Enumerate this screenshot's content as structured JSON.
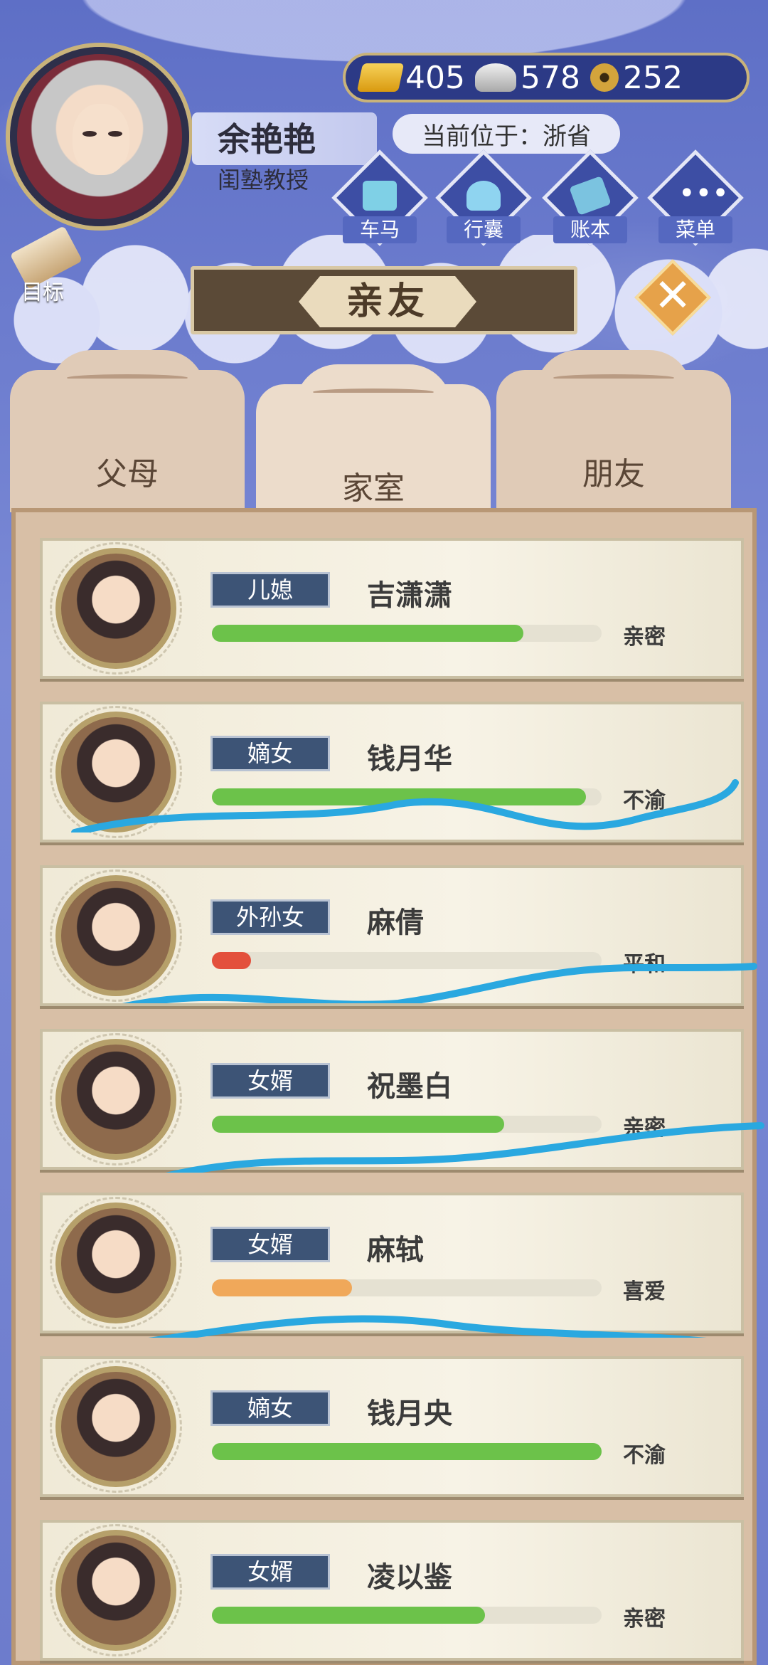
{
  "player": {
    "name": "余艳艳",
    "title": "闺塾教授",
    "location": "当前位于：浙省"
  },
  "currency": {
    "gold": "405",
    "silver": "578",
    "coins": "252"
  },
  "nav": {
    "carriage": "车马",
    "luggage": "行囊",
    "ledger": "账本",
    "menu": "菜单",
    "goal": "目标"
  },
  "page": {
    "title": "亲友"
  },
  "tabs": [
    {
      "label": "父母"
    },
    {
      "label": "家室"
    },
    {
      "label": "朋友"
    }
  ],
  "members": [
    {
      "relation": "儿媳",
      "name": "吉潇潇",
      "mood": "亲密",
      "affinity": 0.8,
      "color": "#6cc24a"
    },
    {
      "relation": "嫡女",
      "name": "钱月华",
      "mood": "不渝",
      "affinity": 0.96,
      "color": "#6cc24a"
    },
    {
      "relation": "外孙女",
      "name": "麻倩",
      "mood": "平和",
      "affinity": 0.1,
      "color": "#e3503c"
    },
    {
      "relation": "女婿",
      "name": "祝墨白",
      "mood": "亲密",
      "affinity": 0.75,
      "color": "#6cc24a"
    },
    {
      "relation": "女婿",
      "name": "麻轼",
      "mood": "喜爱",
      "affinity": 0.36,
      "color": "#f0a85a"
    },
    {
      "relation": "嫡女",
      "name": "钱月央",
      "mood": "不渝",
      "affinity": 1.0,
      "color": "#6cc24a"
    },
    {
      "relation": "女婿",
      "name": "凌以鉴",
      "mood": "亲密",
      "affinity": 0.7,
      "color": "#6cc24a"
    }
  ]
}
